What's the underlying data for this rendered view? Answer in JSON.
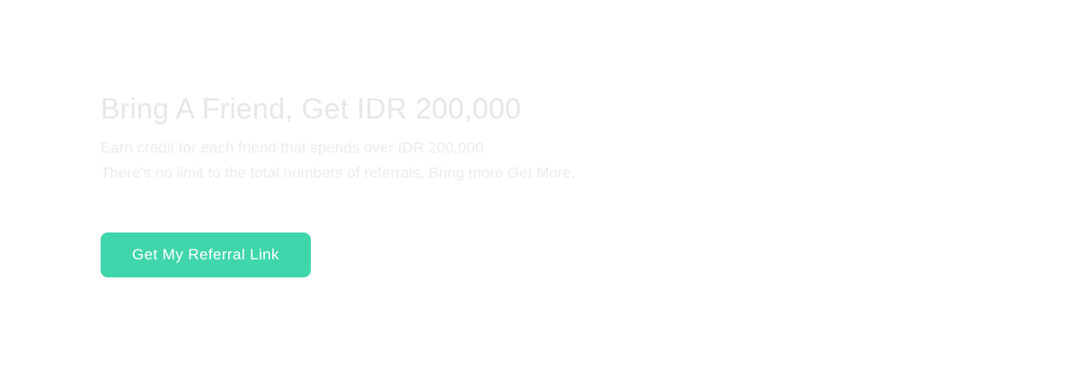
{
  "referral": {
    "title": "Bring A Friend, Get IDR 200,000",
    "description_lines": [
      "Earn credit for each friend that spends over IDR 200,000",
      "There's no limit to the total numbers of referrals, Bring more Get More."
    ],
    "cta_label": "Get My Referral Link"
  },
  "colors": {
    "background": "#ffffff",
    "title": "#e6e7e8",
    "description": "#ebecec",
    "cta_background": "#40d6ab",
    "cta_text": "#ffffff"
  }
}
